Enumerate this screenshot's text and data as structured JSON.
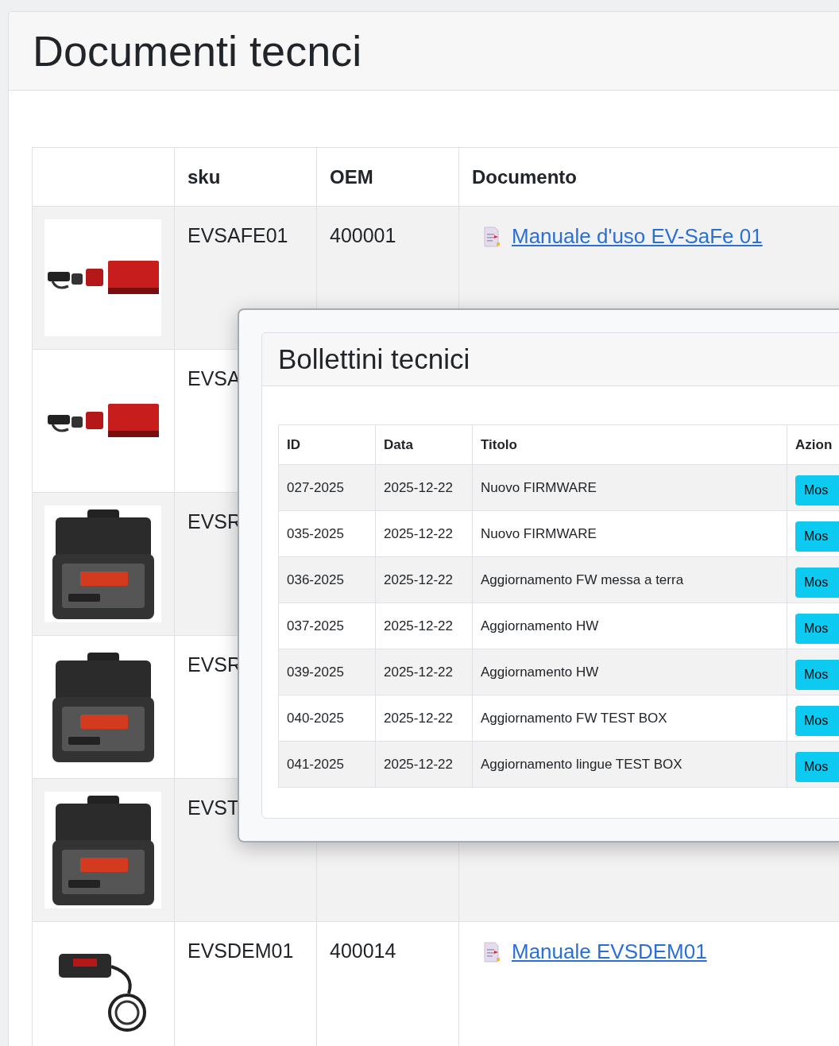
{
  "page": {
    "title": "Documenti tecnci"
  },
  "table": {
    "columns": [
      "sku",
      "OEM",
      "Documento"
    ],
    "rows": [
      {
        "sku": "EVSAFE01",
        "oem": "400001",
        "document": "Manuale d'uso EV-SaFe 01"
      },
      {
        "sku": "EVSA"
      },
      {
        "sku": "EVSR"
      },
      {
        "sku": "EVSR"
      },
      {
        "sku": "EVST"
      },
      {
        "sku": "EVSDEM01",
        "oem": "400014",
        "document": "Manuale EVSDEM01"
      }
    ]
  },
  "modal": {
    "title": "Bollettini tecnici",
    "columns": [
      "ID",
      "Data",
      "Titolo",
      "Azion"
    ],
    "rows": [
      {
        "id": "027-2025",
        "date": "2025-12-22",
        "title": "Nuovo FIRMWARE",
        "action": "Mos"
      },
      {
        "id": "035-2025",
        "date": "2025-12-22",
        "title": "Nuovo FIRMWARE",
        "action": "Mos"
      },
      {
        "id": "036-2025",
        "date": "2025-12-22",
        "title": "Aggiornamento FW messa a terra",
        "action": "Mos"
      },
      {
        "id": "037-2025",
        "date": "2025-12-22",
        "title": "Aggiornamento HW",
        "action": "Mos"
      },
      {
        "id": "039-2025",
        "date": "2025-12-22",
        "title": "Aggiornamento HW",
        "action": "Mos"
      },
      {
        "id": "040-2025",
        "date": "2025-12-22",
        "title": "Aggiornamento FW TEST BOX",
        "action": "Mos"
      },
      {
        "id": "041-2025",
        "date": "2025-12-22",
        "title": "Aggiornamento lingue TEST BOX",
        "action": "Mos"
      }
    ]
  }
}
